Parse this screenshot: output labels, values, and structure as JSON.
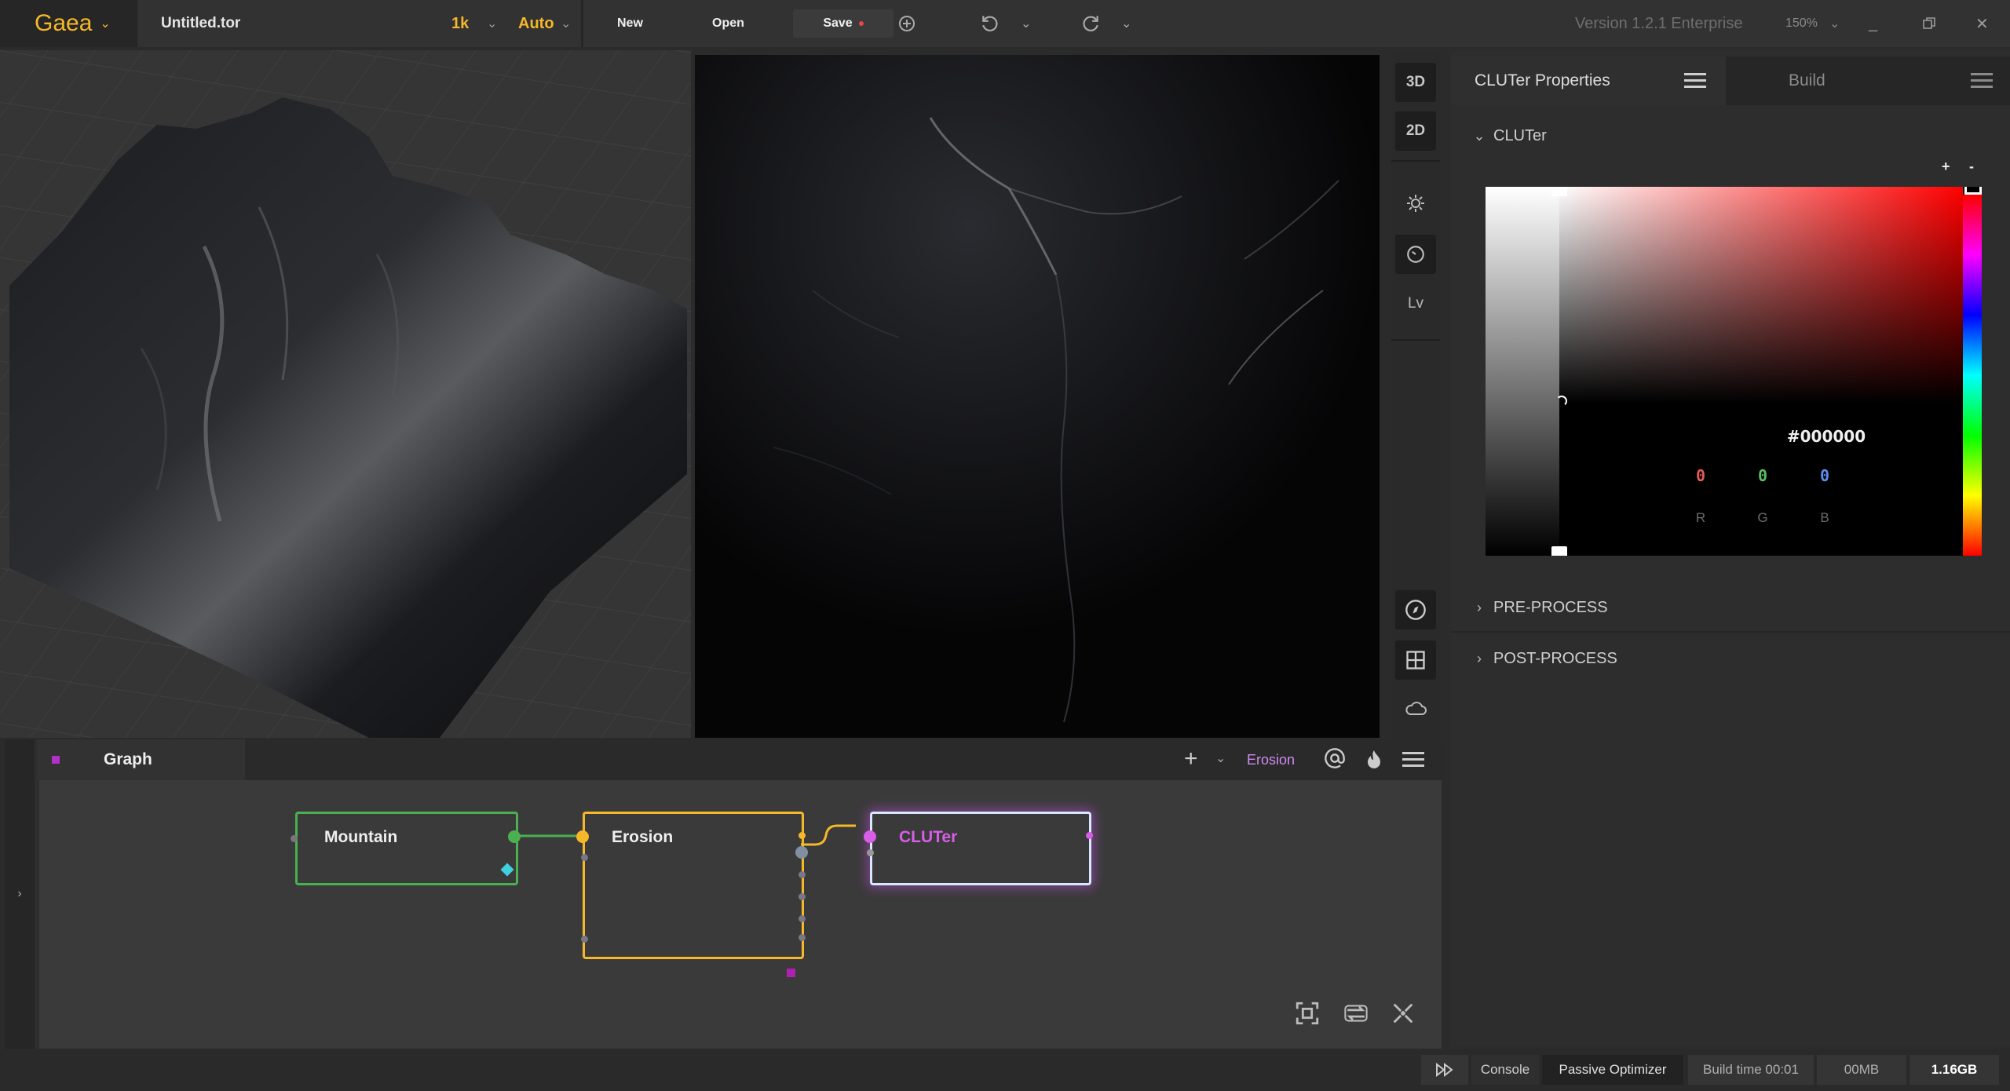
{
  "topbar": {
    "app_name": "Gaea",
    "file_name": "Untitled.tor",
    "resolution": "1k",
    "build_mode": "Auto",
    "new_label": "New",
    "open_label": "Open",
    "save_label": "Save",
    "version": "Version 1.2.1 Enterprise",
    "zoom": "150%",
    "accent_color": "#f5b829"
  },
  "viewport_tools": {
    "mode_3d": "3D",
    "mode_2d": "2D",
    "levels": "Lv"
  },
  "properties": {
    "tab_active": "CLUTer Properties",
    "tab_build": "Build",
    "section_cluter": "CLUTer",
    "add_label": "+",
    "remove_label": "-",
    "hex": "#000000",
    "r_value": "0",
    "g_value": "0",
    "b_value": "0",
    "r_label": "R",
    "g_label": "G",
    "b_label": "B",
    "section_pre": "PRE-PROCESS",
    "section_post": "POST-PROCESS"
  },
  "graph": {
    "tab_label": "Graph",
    "active_node": "Erosion",
    "nodes": [
      {
        "label": "Mountain",
        "color": "#4caf50"
      },
      {
        "label": "Erosion",
        "color": "#f5b829"
      },
      {
        "label": "CLUTer",
        "color": "#d85ee8"
      }
    ]
  },
  "statusbar": {
    "console": "Console",
    "optimizer": "Passive Optimizer",
    "build_time": "Build time 00:01",
    "mem1": "00MB",
    "mem2": "1.16GB"
  }
}
